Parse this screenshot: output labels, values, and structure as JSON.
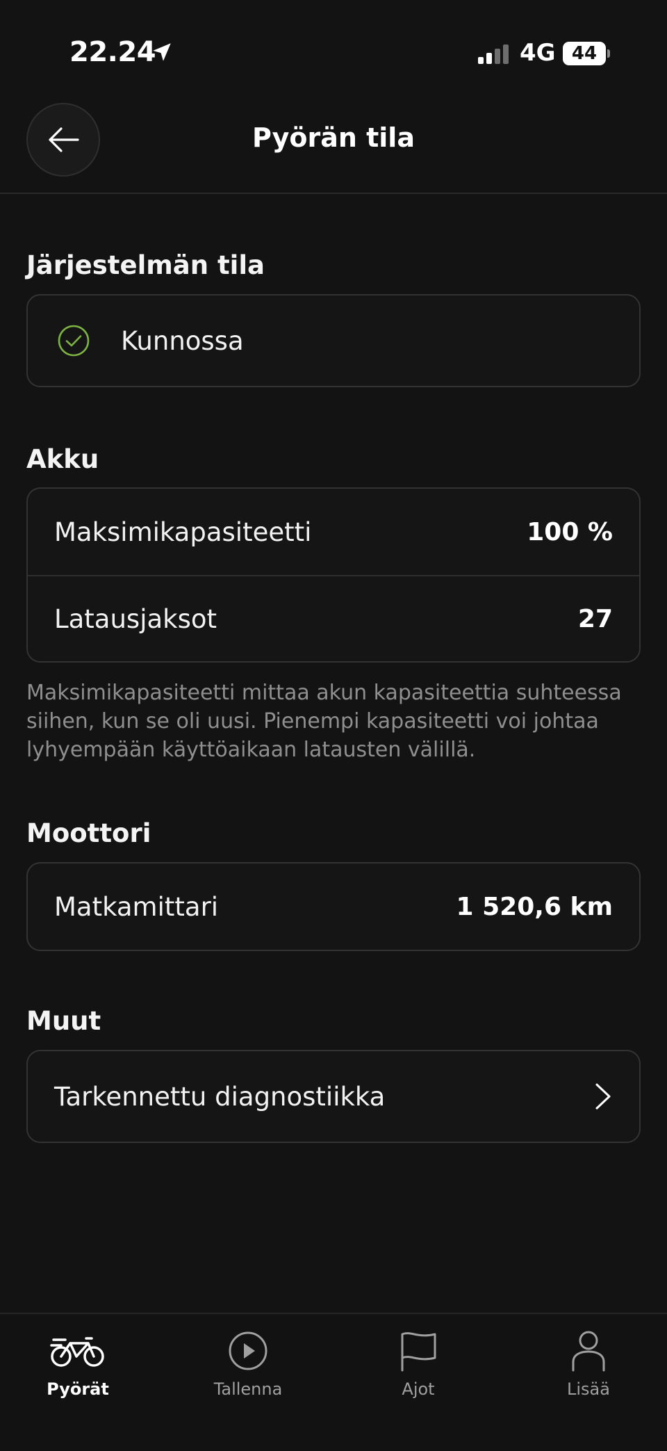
{
  "status_bar": {
    "time": "22.24",
    "network": "4G",
    "battery": "44"
  },
  "header": {
    "title": "Pyörän tila"
  },
  "system": {
    "title": "Järjestelmän tila",
    "status": "Kunnossa",
    "status_color": "#7cb342"
  },
  "battery_section": {
    "title": "Akku",
    "rows": [
      {
        "label": "Maksimikapasiteetti",
        "value": "100 %"
      },
      {
        "label": "Latausjaksot",
        "value": "27"
      }
    ],
    "note": "Maksimikapasiteetti mittaa akun kapasiteettia suhteessa siihen, kun se oli uusi. Pienempi kapasiteetti voi johtaa lyhyempään käyttöaikaan latausten välillä."
  },
  "motor": {
    "title": "Moottori",
    "rows": [
      {
        "label": "Matkamittari",
        "value": "1 520,6 km"
      }
    ]
  },
  "other": {
    "title": "Muut",
    "rows": [
      {
        "label": "Tarkennettu diagnostiikka"
      }
    ]
  },
  "tabs": [
    {
      "label": "Pyörät",
      "icon": "bike-icon",
      "active": true
    },
    {
      "label": "Tallenna",
      "icon": "play-circle-icon",
      "active": false
    },
    {
      "label": "Ajot",
      "icon": "flag-icon",
      "active": false
    },
    {
      "label": "Lisää",
      "icon": "person-icon",
      "active": false
    }
  ]
}
